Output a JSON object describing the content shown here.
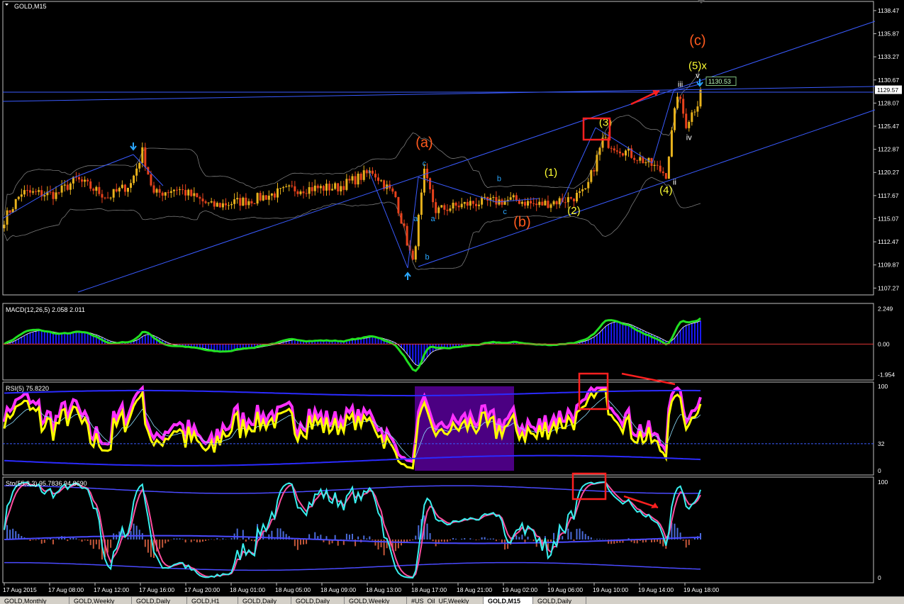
{
  "window": {
    "symbol_label": "GOLD,M15"
  },
  "colors": {
    "background": "#000000",
    "grid": "#2a2a2a",
    "bull": "#e8b21c",
    "bear": "#e8421c",
    "trendline": "#3a5bff",
    "bands": "#7a7a7a",
    "wave_orange": "#ff5a1e",
    "wave_yellow": "#ffff33",
    "wave_blue": "#2aa7ff",
    "box_red": "#ff2020",
    "macd_line": "#22e022",
    "macd_hist": "#1a1aff",
    "rsi": "#ffff00",
    "rsi_shadow": "#ff30ff",
    "stoch_main": "#38f0f0",
    "stoch_signal": "#ff4fa0",
    "band_violet": "#4b0082"
  },
  "chart_data": [
    {
      "type": "candlestick",
      "panel": "price",
      "title": "GOLD,M15",
      "ylim": [
        1106.5,
        1139.5
      ],
      "y_ticks": [
        "1138.47",
        "1135.87",
        "1133.27",
        "1130.67",
        "1128.07",
        "1125.47",
        "1122.87",
        "1120.27",
        "1117.67",
        "1115.07",
        "1112.47",
        "1109.87",
        "1107.27"
      ],
      "current_price": "1129.57",
      "line_price": "1130.53",
      "bars": 243,
      "waypoints": [
        [
          0,
          1115.0
        ],
        [
          6,
          1118.0
        ],
        [
          18,
          1117.8
        ],
        [
          25,
          1119.5
        ],
        [
          36,
          1117.5
        ],
        [
          44,
          1119.0
        ],
        [
          48,
          1122.6
        ],
        [
          52,
          1117.8
        ],
        [
          60,
          1118.5
        ],
        [
          72,
          1116.5
        ],
        [
          86,
          1117.2
        ],
        [
          100,
          1118.4
        ],
        [
          116,
          1118.6
        ],
        [
          128,
          1120.4
        ],
        [
          136,
          1117.5
        ],
        [
          142,
          1110.0
        ],
        [
          146,
          1120.1
        ],
        [
          150,
          1116.0
        ],
        [
          162,
          1116.8
        ],
        [
          178,
          1117.2
        ],
        [
          185,
          1116.6
        ],
        [
          196,
          1117.3
        ],
        [
          202,
          1118.0
        ],
        [
          208,
          1123.9
        ],
        [
          216,
          1122.6
        ],
        [
          224,
          1121.3
        ],
        [
          230,
          1120.1
        ],
        [
          234,
          1129.2
        ],
        [
          237,
          1125.7
        ],
        [
          240,
          1127.5
        ],
        [
          243,
          1129.6
        ]
      ],
      "labels": [
        {
          "text": "(a)",
          "x": 146,
          "y": 1123.1,
          "color": "wave_orange"
        },
        {
          "text": "(b)",
          "x": 180,
          "y": 1114.2,
          "color": "wave_orange"
        },
        {
          "text": "(c)",
          "x": 241,
          "y": 1134.6,
          "color": "wave_orange"
        },
        {
          "text": "(1)",
          "x": 190,
          "y": 1119.9,
          "color": "wave_yellow"
        },
        {
          "text": "(2)",
          "x": 198,
          "y": 1115.6,
          "color": "wave_yellow"
        },
        {
          "text": "(3)",
          "x": 209,
          "y": 1125.5,
          "color": "wave_yellow"
        },
        {
          "text": "(4)",
          "x": 230,
          "y": 1117.9,
          "color": "wave_yellow"
        },
        {
          "text": "(5)x",
          "x": 241,
          "y": 1131.9,
          "color": "wave_yellow"
        },
        {
          "text": "a",
          "x": 143,
          "y": 1114.8,
          "color": "wave_blue"
        },
        {
          "text": "a",
          "x": 149,
          "y": 1114.8,
          "color": "wave_blue"
        },
        {
          "text": "b",
          "x": 147,
          "y": 1110.5,
          "color": "wave_blue"
        },
        {
          "text": "c",
          "x": 146,
          "y": 1121.0,
          "color": "wave_blue"
        },
        {
          "text": "b",
          "x": 172,
          "y": 1119.3,
          "color": "wave_blue"
        },
        {
          "text": "c",
          "x": 174,
          "y": 1115.6,
          "color": "wave_blue"
        },
        {
          "text": "ii",
          "x": 233,
          "y": 1118.9,
          "color": "white"
        },
        {
          "text": "iii",
          "x": 235,
          "y": 1129.9,
          "color": "white"
        },
        {
          "text": "iv",
          "x": 238,
          "y": 1123.9,
          "color": "white"
        },
        {
          "text": "v",
          "x": 241,
          "y": 1130.9,
          "color": "white"
        }
      ]
    },
    {
      "type": "line",
      "panel": "macd",
      "title": "MACD(12,26,5) 2.058 2.011",
      "y_ticks": [
        "2.249",
        "0.00",
        "-1.954"
      ],
      "ylim": [
        -2.3,
        2.6
      ]
    },
    {
      "type": "line",
      "panel": "rsi",
      "title": "RSI(5) 75.8220",
      "y_ticks": [
        "100",
        "32",
        "0"
      ],
      "ylim": [
        -5,
        105
      ]
    },
    {
      "type": "line",
      "panel": "stochastic",
      "title": "Sto(55,3,3) 95.7836 94.8690",
      "y_ticks": [
        "100",
        "0"
      ],
      "ylim": [
        -5,
        105
      ]
    }
  ],
  "x_axis": {
    "labels": [
      "17 Aug 2015",
      "17 Aug 08:00",
      "17 Aug 12:00",
      "17 Aug 16:00",
      "17 Aug 20:00",
      "18 Aug 01:00",
      "18 Aug 05:00",
      "18 Aug 09:00",
      "18 Aug 13:00",
      "18 Aug 17:00",
      "18 Aug 21:00",
      "19 Aug 02:00",
      "19 Aug 06:00",
      "19 Aug 10:00",
      "19 Aug 14:00",
      "19 Aug 18:00"
    ]
  },
  "tabs": [
    {
      "label": "GOLD,Monthly",
      "active": false
    },
    {
      "label": "GOLD,Weekly",
      "active": false
    },
    {
      "label": "GOLD,Daily",
      "active": false
    },
    {
      "label": "GOLD,H1",
      "active": false
    },
    {
      "label": "GOLD,Daily",
      "active": false
    },
    {
      "label": "GOLD,Daily",
      "active": false
    },
    {
      "label": "GOLD,Weekly",
      "active": false
    },
    {
      "label": "#US_Oil_UF,Weekly",
      "active": false
    },
    {
      "label": "GOLD,M15",
      "active": true
    },
    {
      "label": "GOLD,Daily",
      "active": false
    }
  ]
}
